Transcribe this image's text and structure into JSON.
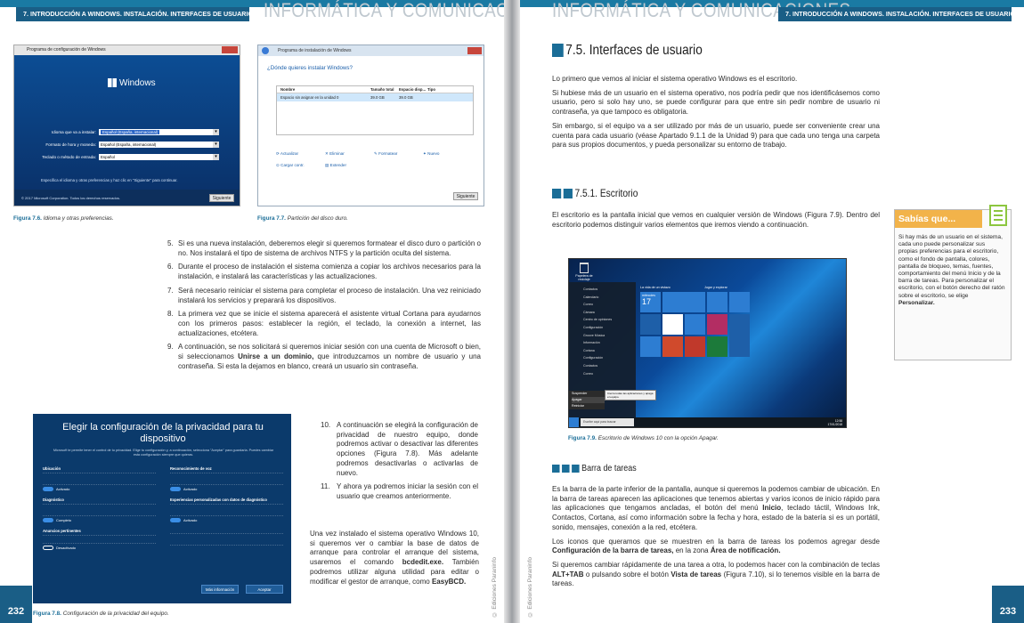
{
  "left_page": {
    "running_header": "7. INTRODUCCIÓN A WINDOWS. INSTALACIÓN. INTERFACES DE USUARIO",
    "ghost_title": "INFORMÁTICA Y COMUNICACIONES",
    "page_number": "232",
    "fig76": {
      "window_title": "Programa de configuración de Windows",
      "logo": "Windows",
      "rows": [
        {
          "label": "Idioma que va a instalar:",
          "value": "Español (España, internacional)"
        },
        {
          "label": "Formato de hora y moneda:",
          "value": "Español (España, internacional)"
        },
        {
          "label": "Teclado o método de entrada:",
          "value": "Español"
        }
      ],
      "hint": "Especifica el idioma y otras preferencias y haz clic en \"Siguiente\" para continuar.",
      "copyright": "© 2017 Microsoft Corporation. Todos los derechos reservados.",
      "next": "Siguiente",
      "caption_label": "Figura 7.6.",
      "caption_text": "Idioma y otras preferencias."
    },
    "fig77": {
      "window_title": "Programa de instalación de Windows",
      "question": "¿Dónde quieres instalar Windows?",
      "columns": [
        "Nombre",
        "Tamaño total",
        "Espacio disp...",
        "Tipo"
      ],
      "row": [
        "Espacio sin asignar en la unidad 0",
        "39.0 GB",
        "39.0 GB",
        ""
      ],
      "actions": [
        "Actualizar",
        "Eliminar",
        "Formatear",
        "Nuevo",
        "Cargar contr.",
        "Extender"
      ],
      "next": "Siguiente",
      "caption_label": "Figura 7.7.",
      "caption_text": "Partición del disco duro."
    },
    "steps": [
      {
        "n": "5.",
        "text": "Si es una nueva instalación, deberemos elegir si queremos formatear el disco duro o partición o no. Nos instalará el tipo de sistema de archivos NTFS y la partición oculta del sistema."
      },
      {
        "n": "6.",
        "text": "Durante el proceso de instalación el sistema comienza a copiar los archivos necesarios para la instalación, e instalará las características y las actualizaciones."
      },
      {
        "n": "7.",
        "text": "Será necesario reiniciar el sistema para completar el proceso de instalación. Una vez reiniciado instalará los servicios y preparará los dispositivos."
      },
      {
        "n": "8.",
        "text": "La primera vez que se inicie el sistema aparecerá el asistente virtual Cortana para ayudarnos con los primeros pasos: establecer la región, el teclado, la conexión a internet, las actualizaciones, etcétera."
      },
      {
        "n": "9.",
        "text_before": "A continuación, se nos solicitará si queremos iniciar sesión con una cuenta de Microsoft o bien, si seleccionamos ",
        "bold": "Unirse a un dominio,",
        "text_after": " que introduzcamos un nombre de usuario y una contraseña. Si esta la dejamos en blanco, creará un usuario sin contraseña."
      }
    ],
    "fig78": {
      "title": "Elegir la configuración de la privacidad para tu dispositivo",
      "subtitle": "Microsoft te permite tener el control de tu privacidad. Elige tu configuración y, a continuación, selecciona \"Aceptar\" para guardarla. Puedes cambiar esta configuración siempre que quieras.",
      "items": [
        {
          "h": "Ubicación",
          "state": "Activado"
        },
        {
          "h": "Reconocimiento de voz",
          "state": "Activado"
        },
        {
          "h": "Diagnóstico",
          "state": "Completo"
        },
        {
          "h": "Experiencias personalizadas con datos de diagnóstico",
          "state": "Activado"
        },
        {
          "h": "Anuncios pertinentes",
          "state": "Desactivado"
        },
        {
          "h": "",
          "state": ""
        }
      ],
      "more": "Más información",
      "accept": "Aceptar",
      "caption_label": "Figura 7.8.",
      "caption_text": "Configuración de la privacidad del equipo."
    },
    "steps2": [
      {
        "n": "10.",
        "text": "A continuación se elegirá la configuración de privacidad de nuestro equipo, donde podremos activar o desactivar las diferentes opciones (Figura 7.8). Más adelante podremos desactivarlas o activarlas de nuevo."
      },
      {
        "n": "11.",
        "text": "Y ahora ya podremos iniciar la sesión con el usuario que creamos anteriormente."
      }
    ],
    "closing": {
      "t1": "Una vez instalado el sistema operativo Windows 10, si queremos ver o cambiar la base de datos de arranque para controlar el arranque del sistema, usaremos el comando ",
      "b1": "bcdedit.exe.",
      "t2": " También podremos utilizar alguna utilidad para editar o modificar el gestor de arranque, como ",
      "b2": "EasyBCD."
    },
    "side_credit": "© Ediciones Paraninfo"
  },
  "right_page": {
    "running_header": "7. INTRODUCCIÓN A WINDOWS. INSTALACIÓN. INTERFACES DE USUARIO",
    "ghost_title": "INFORMÁTICA Y COMUNICACIONES",
    "page_number": "233",
    "side_credit": "© Ediciones Paraninfo",
    "h1": "7.5. Interfaces de usuario",
    "p1": "Lo primero que vemos al iniciar el sistema operativo Windows es el escritorio.",
    "p2": "Si hubiese más de un usuario en el sistema operativo, nos podría pedir que nos identificásemos como usuario, pero si solo hay uno, se puede configurar para que entre sin pedir nombre de usuario ni contraseña, ya que tampoco es obligatoria.",
    "p3": "Sin embargo, si el equipo va a ser utilizado por más de un usuario, puede ser conveniente crear una cuenta para cada usuario (véase Apartado 9.1.1 de la Unidad 9) para que cada uno tenga una carpeta para sus propios documentos, y pueda personalizar su entorno de trabajo.",
    "h2": "7.5.1. Escritorio",
    "p4": "El escritorio es la pantalla inicial que vemos en cualquier versión de Windows (Figura 7.9). Dentro del escritorio podemos distinguir varios elementos que iremos viendo a continuación.",
    "sabias": {
      "title": "Sabías que...",
      "text": "Si hay más de un usuario en el sistema, cada uno puede personalizar sus propias preferencias para el escritorio, como el fondo de pantalla, colores, pantalla de bloqueo, temas, fuentes, comportamiento del menú Inicio y de la barra de tareas. Para personalizar el escritorio, con el botón derecho del ratón sobre el escritorio, se elige ",
      "bold": "Personalizar."
    },
    "fig79": {
      "recycle": "Papelera de reciclaje",
      "start_items": [
        "Contactos",
        "Calendario",
        "Correo",
        "Cámara",
        "Centro de opiniones",
        "Configuración",
        "Groove Música",
        "Información",
        "Cortana",
        "Configuración",
        "Contactos",
        "Correo"
      ],
      "group1": "La vida de un vistazo",
      "group2": "Jugar y explorar",
      "tile_day": "miércoles",
      "tile_num": "17",
      "search": "Escribe aquí para buscar",
      "power": [
        "Suspender",
        "Apagar",
        "Reiniciar"
      ],
      "tooltip": "Cierra todas las aplicaciones y apaga el equipo.",
      "time": "12:58",
      "date": "17/01/2018",
      "caption_label": "Figura 7.9.",
      "caption_text": "Escritorio de Windows 10 con la opción Apagar."
    },
    "h3": "Barra de tareas",
    "p5_before": "Es la barra de la parte inferior de la pantalla, aunque si queremos la podemos cambiar de ubicación. En la barra de tareas aparecen las aplicaciones que tenemos abiertas y varios iconos de inicio rápido para las aplicaciones que tengamos ancladas, el botón del menú ",
    "p5_bold": "Inicio",
    "p5_after": ", teclado táctil, Windows Ink, Contactos, Cortana, así como información sobre la fecha y hora, estado de la batería si es un portátil, sonido, mensajes, conexión a la red, etcétera.",
    "p6_before": "Los iconos que queramos que se muestren en la barra de tareas los podemos agregar desde ",
    "p6_b1": "Configuración de la barra de tareas,",
    "p6_mid": " en la zona ",
    "p6_b2": "Área de notificación.",
    "p7_before": "Si queremos cambiar rápidamente de una tarea a otra, lo podemos hacer con la combinación de teclas ",
    "p7_b1": "ALT+TAB",
    "p7_mid": " o pulsando sobre el botón ",
    "p7_b2": "Vista de tareas",
    "p7_after": " (Figura 7.10), si lo tenemos visible en la barra de tareas."
  },
  "colors": {
    "accent": "#1a6d97",
    "header": "#1a5e86",
    "sabias": "#f2b34a",
    "note_green": "#8cc63f"
  }
}
